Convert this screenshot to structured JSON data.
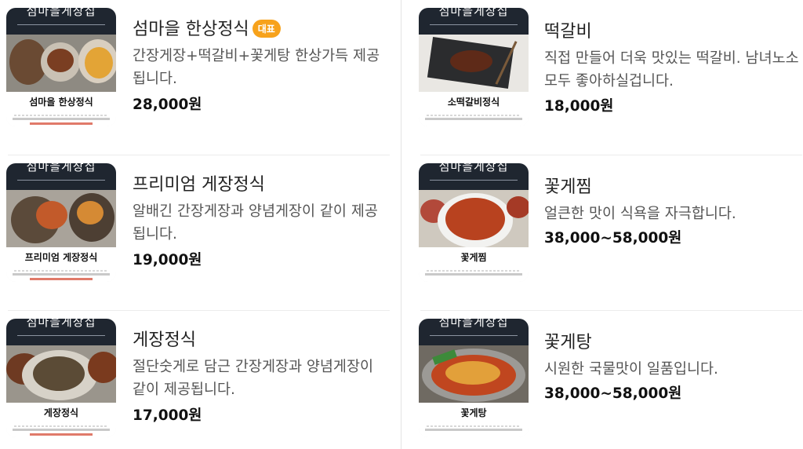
{
  "menu": {
    "items": [
      {
        "name": "섬마을 한상정식",
        "badge": "대표",
        "description": "간장게장+떡갈비+꽃게탕 한상가득 제공됩니다.",
        "price": "28,000원",
        "thumb_title": "섬마을 한상정식"
      },
      {
        "name": "떡갈비",
        "description": "직접 만들어 더욱 맛있는 떡갈비. 남녀노소 모두 좋아하실겁니다.",
        "price": "18,000원",
        "thumb_title": "소떡갈비정식"
      },
      {
        "name": "프리미엄 게장정식",
        "description": "알배긴 간장게장과 양념게장이 같이 제공됩니다.",
        "price": "19,000원",
        "thumb_title": "프리미엄 게장정식"
      },
      {
        "name": "꽃게찜",
        "description": "얼큰한 맛이 식욕을 자극합니다.",
        "price": "38,000~58,000원",
        "thumb_title": "꽃게찜"
      },
      {
        "name": "게장정식",
        "description": "절단숫게로 담근 간장게장과 양념게장이 같이 제공됩니다.",
        "price": "17,000원",
        "thumb_title": "게장정식"
      },
      {
        "name": "꽃게탕",
        "description": "시원한 국물맛이 일품입니다.",
        "price": "38,000~58,000원",
        "thumb_title": "꽃게탕"
      }
    ],
    "thumb_header": "섬마을게장집"
  },
  "colors": {
    "badge": "#f7a21b",
    "thumb_header_bg": "#1f2630",
    "divider": "#ececec"
  }
}
